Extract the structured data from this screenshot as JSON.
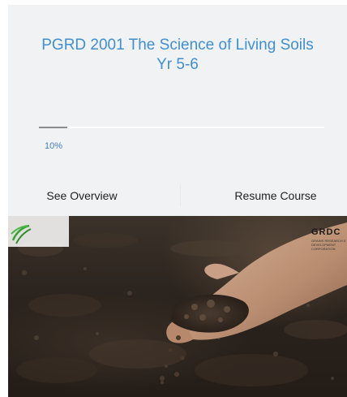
{
  "course": {
    "title": "PGRD 2001 The Science of Living Soils Yr 5-6",
    "progress_percent": 10,
    "progress_label": "10%"
  },
  "actions": {
    "overview_label": "See Overview",
    "resume_label": "Resume Course"
  },
  "image": {
    "logo_text": "GRDC",
    "logo_subtext": "GRAINS RESEARCH & DEVELOPMENT CORPORATION"
  },
  "colors": {
    "title": "#3f8fd2",
    "card_background": "#f1f2f3",
    "progress_fill": "#8a8e92"
  }
}
